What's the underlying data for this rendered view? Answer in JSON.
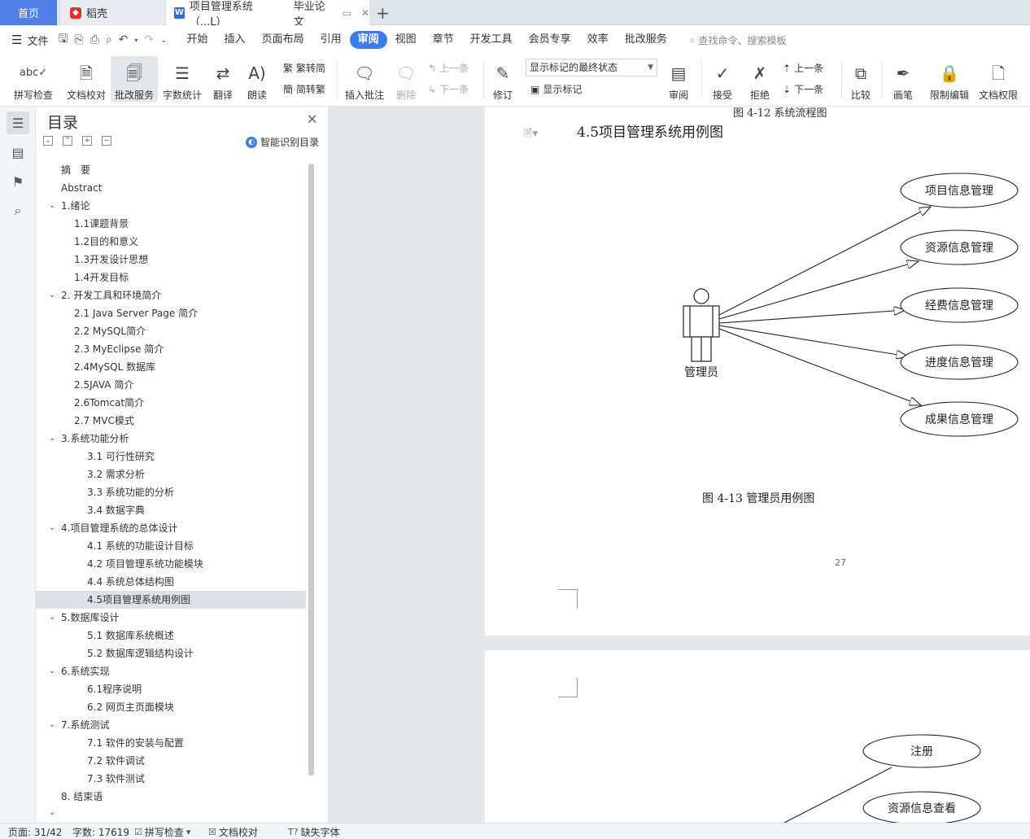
{
  "tabs": {
    "home": "首页",
    "shell": "稻壳",
    "doc": "项目管理系统（...L）",
    "doc_tag": "毕业论文"
  },
  "menu": {
    "file": "文件",
    "items": [
      "开始",
      "插入",
      "页面布局",
      "引用",
      "审阅",
      "视图",
      "章节",
      "开发工具",
      "会员专享",
      "效率",
      "批改服务"
    ],
    "active": "审阅",
    "search_placeholder": "查找命令、搜索模板"
  },
  "ribbon": {
    "spell_check": "拼写检查",
    "doc_proof": "文档校对",
    "correct_service": "批改服务",
    "word_count": "字数统计",
    "translate": "翻译",
    "read_aloud": "朗读",
    "to_traditional": "繁转简",
    "to_simplified": "简转繁",
    "insert_comment": "插入批注",
    "delete": "删除",
    "prev_comment": "上一条",
    "next_comment": "下一条",
    "revise": "修订",
    "markup_state": "显示标记的最终状态",
    "show_markup": "显示标记",
    "review": "审阅",
    "accept": "接受",
    "reject": "拒绝",
    "prev_change": "上一条",
    "next_change": "下一条",
    "compare": "比较",
    "pen": "画笔",
    "restrict_edit": "限制编辑",
    "doc_permission": "文档权限"
  },
  "toc": {
    "title": "目录",
    "smart_label": "智能识别目录",
    "items": [
      {
        "label": "摘　要",
        "level": 1,
        "chev": false
      },
      {
        "label": "Abstract",
        "level": 1,
        "chev": false
      },
      {
        "label": "1.绪论",
        "level": 1,
        "chev": true
      },
      {
        "label": "1.1课题背景",
        "level": 2,
        "chev": false
      },
      {
        "label": "1.2目的和意义",
        "level": 2,
        "chev": false
      },
      {
        "label": "1.3开发设计思想",
        "level": 2,
        "chev": false
      },
      {
        "label": "1.4开发目标",
        "level": 2,
        "chev": false
      },
      {
        "label": "2. 开发工具和环境简介",
        "level": 1,
        "chev": true
      },
      {
        "label": "2.1 Java Server Page  简介",
        "level": 2,
        "chev": false
      },
      {
        "label": "2.2 MySQL简介",
        "level": 2,
        "chev": false
      },
      {
        "label": "2.3 MyEclipse  简介",
        "level": 2,
        "chev": false
      },
      {
        "label": "2.4MySQL  数据库",
        "level": 2,
        "chev": false
      },
      {
        "label": "2.5JAVA  简介",
        "level": 2,
        "chev": false
      },
      {
        "label": "2.6Tomcat简介",
        "level": 2,
        "chev": false
      },
      {
        "label": "2.7 MVC模式",
        "level": 2,
        "chev": false
      },
      {
        "label": "3.系统功能分析",
        "level": 1,
        "chev": true
      },
      {
        "label": "3.1  可行性研究",
        "level": 3,
        "chev": false
      },
      {
        "label": "3.2  需求分析",
        "level": 3,
        "chev": false
      },
      {
        "label": "3.3  系统功能的分析",
        "level": 3,
        "chev": false
      },
      {
        "label": "3.4  数据字典",
        "level": 3,
        "chev": false
      },
      {
        "label": "4.项目管理系统的总体设计",
        "level": 1,
        "chev": true
      },
      {
        "label": "4.1  系统的功能设计目标",
        "level": 3,
        "chev": false
      },
      {
        "label": "4.2  项目管理系统功能模块",
        "level": 3,
        "chev": false
      },
      {
        "label": "4.4  系统总体结构图",
        "level": 3,
        "chev": false
      },
      {
        "label": "4.5项目管理系统用例图",
        "level": 3,
        "chev": false,
        "selected": true
      },
      {
        "label": "5.数据库设计",
        "level": 1,
        "chev": true
      },
      {
        "label": "5.1  数据库系统概述",
        "level": 3,
        "chev": false
      },
      {
        "label": "5.2  数据库逻辑结构设计",
        "level": 3,
        "chev": false
      },
      {
        "label": "6.系统实现",
        "level": 1,
        "chev": true
      },
      {
        "label": "6.1程序说明",
        "level": 3,
        "chev": false
      },
      {
        "label": "6.2  网页主页面模块",
        "level": 3,
        "chev": false
      },
      {
        "label": "7.系统测试",
        "level": 1,
        "chev": true
      },
      {
        "label": "7.1  软件的安装与配置",
        "level": 3,
        "chev": false
      },
      {
        "label": "7.2  软件调试",
        "level": 3,
        "chev": false
      },
      {
        "label": "7.3  软件测试",
        "level": 3,
        "chev": false
      },
      {
        "label": "8.  结束语",
        "level": 1,
        "chev": false
      }
    ]
  },
  "document": {
    "prev_figure_caption": "图 4-12 系统流程图",
    "section_heading": "4.5项目管理系统用例图",
    "actor": "管理员",
    "use_cases": [
      "项目信息管理",
      "资源信息管理",
      "经费信息管理",
      "进度信息管理",
      "成果信息管理"
    ],
    "figure_caption": "图 4-13  管理员用例图",
    "page_number": "27",
    "next_use_cases": [
      "注册",
      "资源信息查看"
    ]
  },
  "status": {
    "page": "页面: 31/42",
    "words": "字数: 17619",
    "spell_check": "拼写检查",
    "doc_proof": "文档校对",
    "missing_font": "缺失字体"
  }
}
